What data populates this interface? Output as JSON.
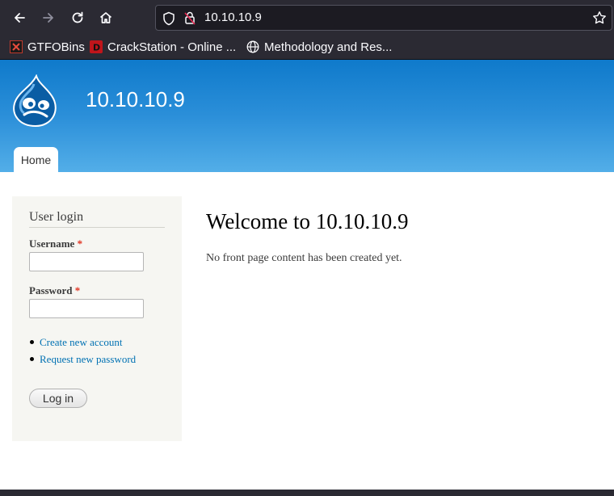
{
  "browser": {
    "url": "10.10.10.9",
    "bookmarks": [
      {
        "label": "GTFOBins",
        "icon": "gtfobins-icon"
      },
      {
        "label": "CrackStation - Online ...",
        "icon": "crackstation-icon"
      },
      {
        "label": "Methodology and Res...",
        "icon": "globe-icon"
      }
    ],
    "colors": {
      "chrome": "#2b2a33",
      "urlbar": "#1c1b22"
    }
  },
  "site": {
    "name": "10.10.10.9",
    "nav": {
      "home_label": "Home"
    },
    "colors": {
      "header_top": "#0f7acb",
      "header_bottom": "#53aee8",
      "link": "#0071b3"
    }
  },
  "login_block": {
    "title": "User login",
    "username_label": "Username",
    "password_label": "Password",
    "required_mark": "*",
    "username_value": "",
    "password_value": "",
    "links": [
      "Create new account",
      "Request new password"
    ],
    "submit_label": "Log in"
  },
  "main": {
    "title": "Welcome to 10.10.10.9",
    "text": "No front page content has been created yet."
  }
}
